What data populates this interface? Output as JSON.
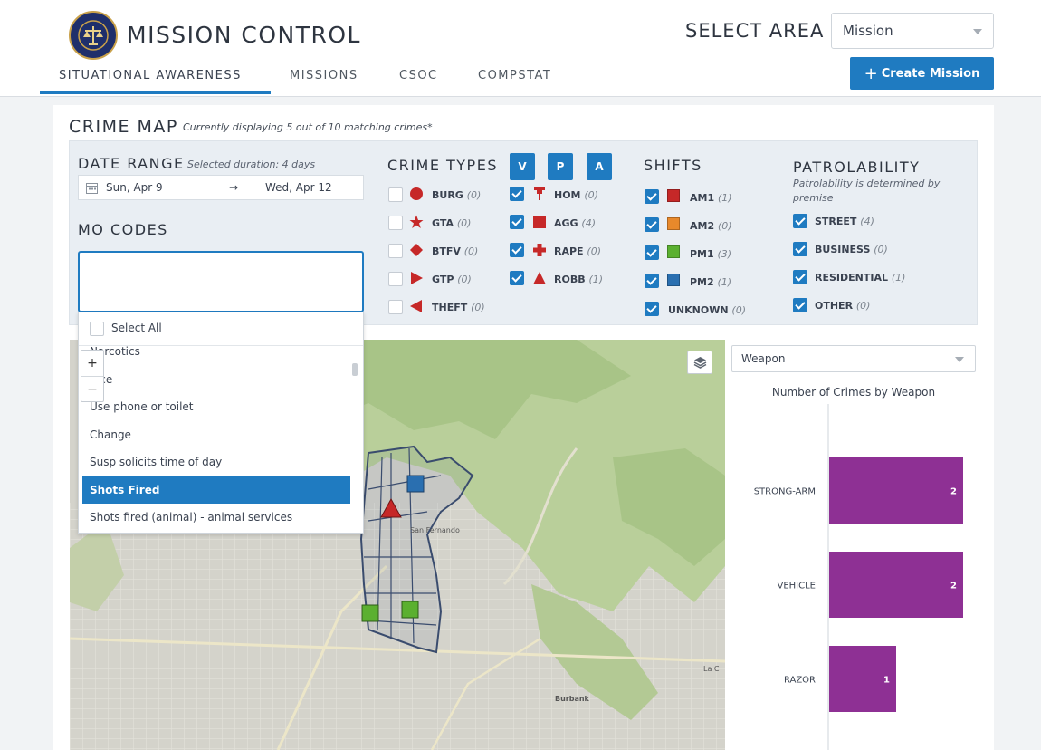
{
  "header": {
    "app_title": "MISSION CONTROL",
    "select_area_label": "SELECT AREA",
    "area_selected": "Mission",
    "create_button": "Create Mission",
    "tabs": [
      {
        "label": "SITUATIONAL AWARENESS",
        "active": true
      },
      {
        "label": "MISSIONS",
        "active": false
      },
      {
        "label": "CSOC",
        "active": false
      },
      {
        "label": "COMPSTAT",
        "active": false
      }
    ]
  },
  "crime_map": {
    "title": "CRIME MAP",
    "note": "Currently displaying 5 out of 10 matching crimes*"
  },
  "date_range": {
    "title": "DATE RANGE",
    "duration": "Selected duration: 4 days",
    "start": "Sun, Apr 9",
    "arrow": "→",
    "end": "Wed, Apr 12"
  },
  "mo_codes": {
    "title": "MO CODES",
    "select_all": "Select All",
    "options": [
      "Narcotics",
      "Vice",
      "Use phone or toilet",
      "Change",
      "Susp solicits time of day",
      "Shots Fired",
      "Shots fired (animal) - animal services"
    ],
    "selected": "Shots Fired"
  },
  "crime_types": {
    "title": "CRIME TYPES",
    "buttons": [
      "V",
      "P",
      "A"
    ],
    "items": [
      {
        "label": "BURG",
        "count": "(0)",
        "checked": false,
        "icon": "circle-icon",
        "color": "#c62828"
      },
      {
        "label": "GTA",
        "count": "(0)",
        "checked": false,
        "icon": "star-icon",
        "color": "#c62828"
      },
      {
        "label": "BTFV",
        "count": "(0)",
        "checked": false,
        "icon": "diamond-icon",
        "color": "#c62828"
      },
      {
        "label": "GTP",
        "count": "(0)",
        "checked": false,
        "icon": "triangle-right-icon",
        "color": "#c62828"
      },
      {
        "label": "THEFT",
        "count": "(0)",
        "checked": false,
        "icon": "triangle-left-icon",
        "color": "#c62828"
      },
      {
        "label": "HOM",
        "count": "(0)",
        "checked": true,
        "icon": "pin-icon",
        "color": "#c62828"
      },
      {
        "label": "AGG",
        "count": "(4)",
        "checked": true,
        "icon": "square-icon",
        "color": "#c62828"
      },
      {
        "label": "RAPE",
        "count": "(0)",
        "checked": true,
        "icon": "cross-icon",
        "color": "#c62828"
      },
      {
        "label": "ROBB",
        "count": "(1)",
        "checked": true,
        "icon": "triangle-up-icon",
        "color": "#c62828"
      }
    ]
  },
  "shifts": {
    "title": "SHIFTS",
    "items": [
      {
        "label": "AM1",
        "count": "(1)",
        "checked": true,
        "color": "#c62828"
      },
      {
        "label": "AM2",
        "count": "(0)",
        "checked": true,
        "color": "#e8892b"
      },
      {
        "label": "PM1",
        "count": "(3)",
        "checked": true,
        "color": "#5bb030"
      },
      {
        "label": "PM2",
        "count": "(1)",
        "checked": true,
        "color": "#2a6fb0"
      },
      {
        "label": "UNKNOWN",
        "count": "(0)",
        "checked": true
      }
    ]
  },
  "patrolability": {
    "title": "PATROLABILITY",
    "note": "Patrolability is determined by premise",
    "items": [
      {
        "label": "STREET",
        "count": "(4)",
        "checked": true
      },
      {
        "label": "BUSINESS",
        "count": "(0)",
        "checked": true
      },
      {
        "label": "RESIDENTIAL",
        "count": "(1)",
        "checked": true
      },
      {
        "label": "OTHER",
        "count": "(0)",
        "checked": true
      }
    ]
  },
  "map": {
    "zoom_in": "+",
    "zoom_out": "−",
    "labels": [
      "San Fernando",
      "Burbank",
      "La C"
    ]
  },
  "weapon_panel": {
    "selected": "Weapon",
    "chart_title": "Number of Crimes by Weapon"
  },
  "chart_data": {
    "type": "bar",
    "orientation": "horizontal",
    "title": "Number of Crimes by Weapon",
    "categories": [
      "STRONG-ARM",
      "VEHICLE",
      "RAZOR"
    ],
    "values": [
      2,
      2,
      1
    ],
    "xlim": [
      0,
      2
    ],
    "color": "#8e3094",
    "grid": false
  }
}
